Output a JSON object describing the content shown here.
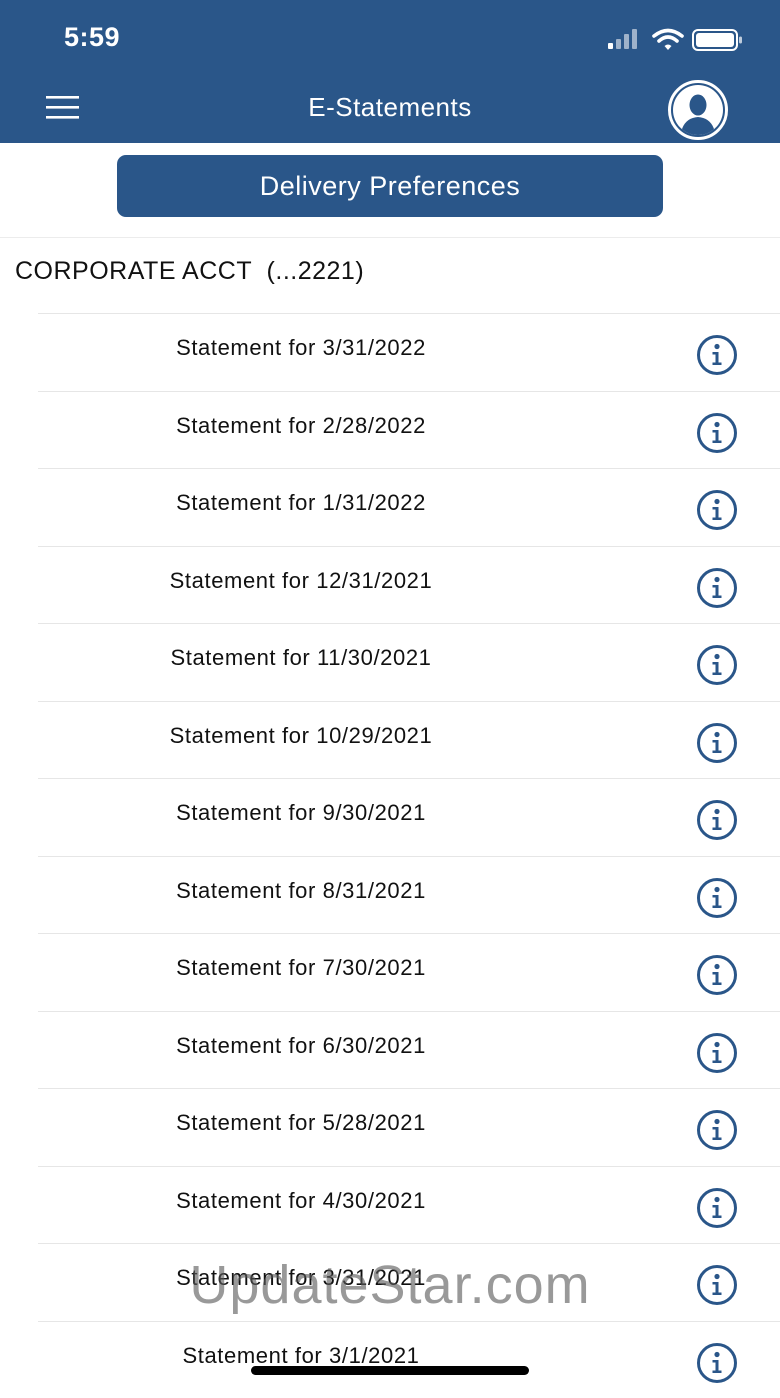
{
  "status_bar": {
    "time": "5:59"
  },
  "header": {
    "title": "E-Statements",
    "menu_icon": "hamburger-menu-icon",
    "profile_icon": "user-profile-icon",
    "background_color": "#2a5689"
  },
  "delivery_button": {
    "label": "Delivery Preferences"
  },
  "account": {
    "title": "CORPORATE ACCT  (...2221)"
  },
  "statements": [
    {
      "label": "Statement for 3/31/2022"
    },
    {
      "label": "Statement for 2/28/2022"
    },
    {
      "label": "Statement for 1/31/2022"
    },
    {
      "label": "Statement for 12/31/2021"
    },
    {
      "label": "Statement for 11/30/2021"
    },
    {
      "label": "Statement for 10/29/2021"
    },
    {
      "label": "Statement for 9/30/2021"
    },
    {
      "label": "Statement for 8/31/2021"
    },
    {
      "label": "Statement for 7/30/2021"
    },
    {
      "label": "Statement for 6/30/2021"
    },
    {
      "label": "Statement for 5/28/2021"
    },
    {
      "label": "Statement for 4/30/2021"
    },
    {
      "label": "Statement for 3/31/2021"
    },
    {
      "label": "Statement for 3/1/2021"
    }
  ],
  "info_icon": "info-icon",
  "accent_color": "#2a5689",
  "watermark": "UpdateStar.com"
}
